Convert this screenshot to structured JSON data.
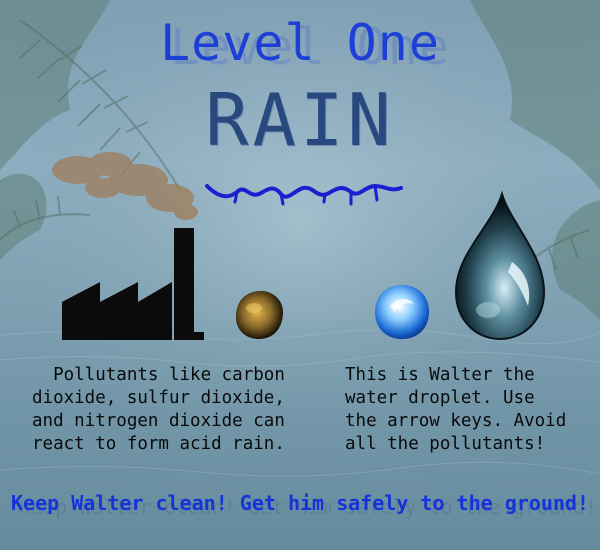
{
  "title": {
    "line1": "Level One",
    "line2": "RAIN"
  },
  "pollutant_info": "  Pollutants like carbon\ndioxide, sulfur dioxide,\nand nitrogen dioxide can\nreact to form acid rain.",
  "walter_info": "This is Walter the\nwater droplet. Use\nthe arrow keys. Avoid\nall the pollutants!",
  "tagline": "Keep Walter clean! Get him safely to the ground!",
  "icons": [
    "factory-icon",
    "smoke-cloud-icon",
    "pollutant-particle-icon",
    "clean-water-orb-icon",
    "water-droplet-icon",
    "rain-squiggle-icon"
  ],
  "colors": {
    "title_blue": "#1d3fd6",
    "rain_navy": "#27497e",
    "tagline_blue": "#1533d8",
    "text": "#0a0a0a"
  }
}
